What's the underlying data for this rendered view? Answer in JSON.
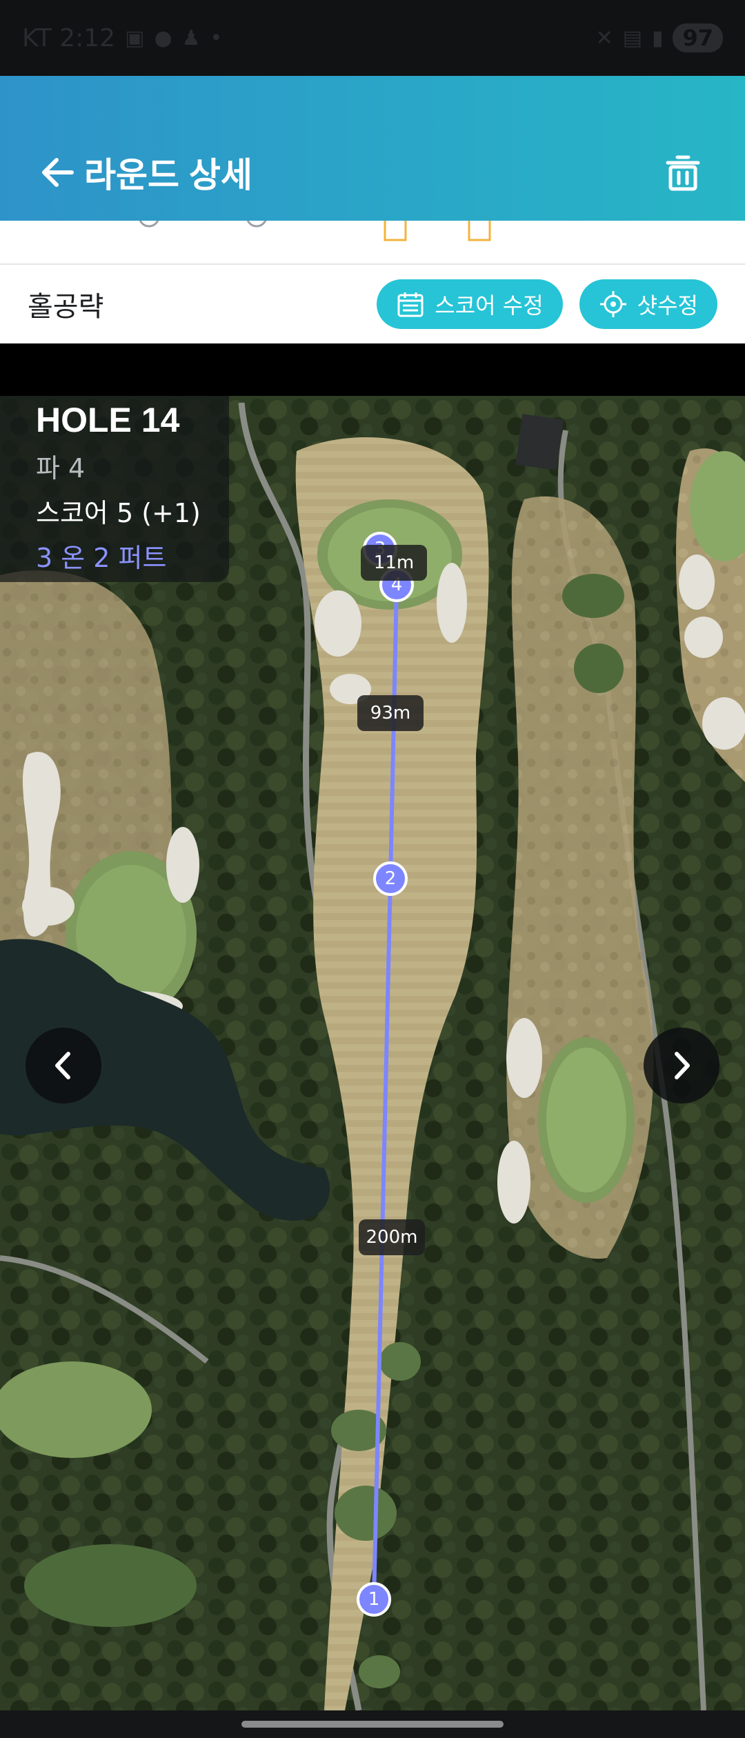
{
  "status_bar": {
    "time": "KT 2:12",
    "battery": "97"
  },
  "header": {
    "title": "라운드 상세",
    "back_icon": "arrow-left-icon",
    "delete_icon": "trash-icon"
  },
  "section": {
    "title": "홀공략",
    "score_edit_label": "스코어 수정",
    "shot_edit_label": "샷수정"
  },
  "hole_info": {
    "title": "HOLE 14",
    "par": "파 4",
    "score": "스코어 5 (+1)",
    "putts": "3 온 2 퍼트"
  },
  "shots": [
    {
      "label": "1"
    },
    {
      "label": "2"
    },
    {
      "label": "3"
    },
    {
      "label": "4"
    }
  ],
  "distances": [
    {
      "label": "200m"
    },
    {
      "label": "93m"
    },
    {
      "label": "11m"
    }
  ],
  "colors": {
    "header_start": "#2e93c9",
    "header_end": "#27b6c6",
    "accent": "#26c4d6",
    "shot_line": "#7d86ff",
    "putt_text": "#8b93ff"
  }
}
